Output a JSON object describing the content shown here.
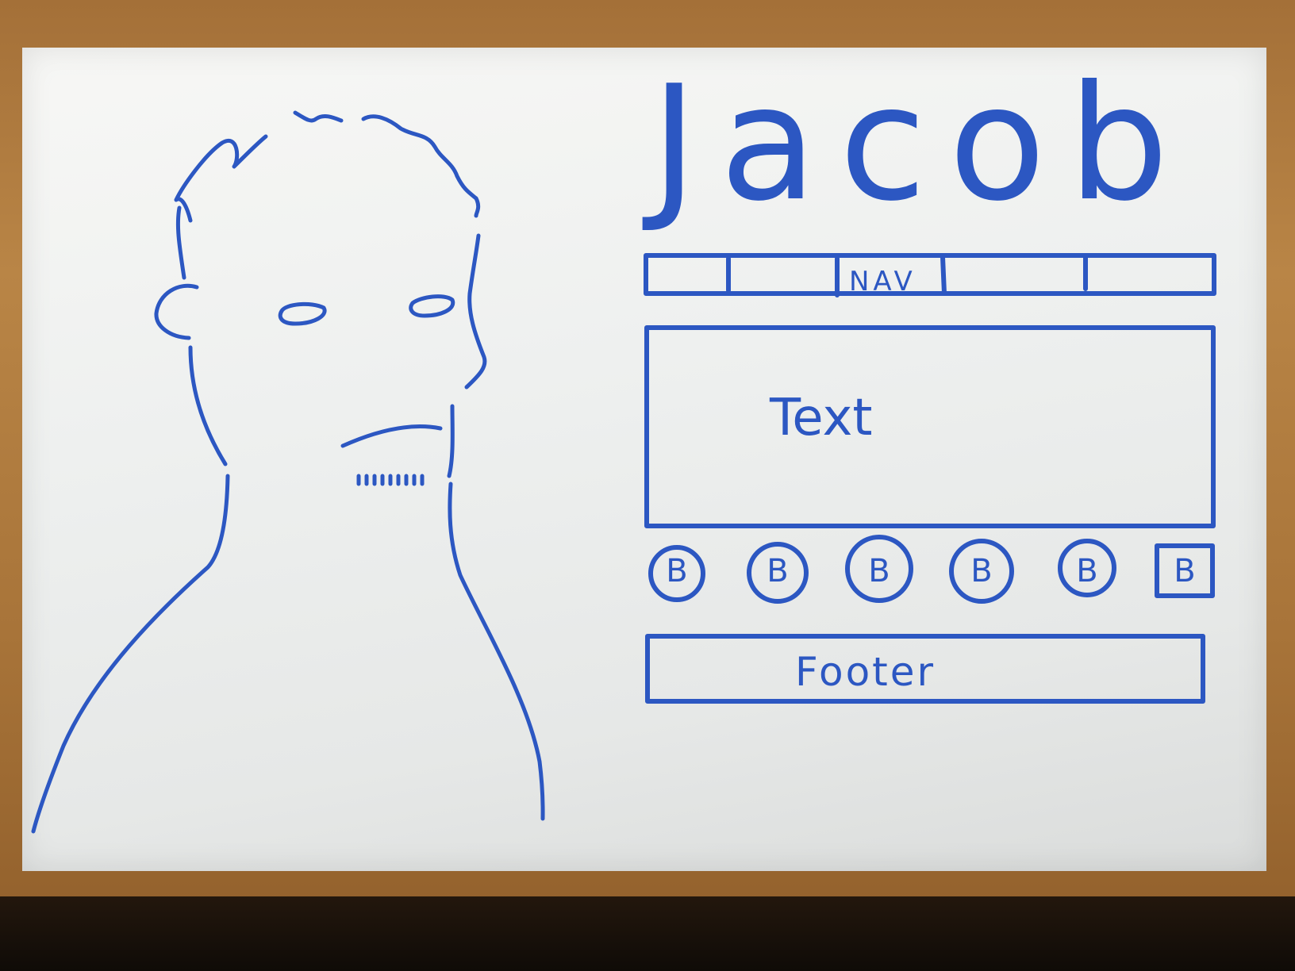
{
  "sketch": {
    "title": "Jacob",
    "nav_label": "NAV",
    "text_label": "Text",
    "footer_label": "Footer",
    "buttons": [
      "B",
      "B",
      "B",
      "B",
      "B",
      "B"
    ]
  },
  "colors": {
    "marker_blue": "#2c57c2",
    "board_white": "#f2f3f1",
    "frame_wood": "#b07a3e"
  }
}
